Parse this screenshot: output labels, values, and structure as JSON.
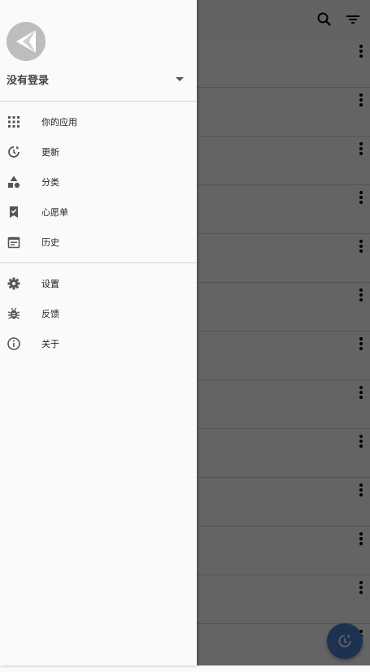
{
  "account": {
    "name": "没有登录"
  },
  "menu_primary": [
    {
      "label": "你的应用",
      "icon": "apps-grid-icon"
    },
    {
      "label": "更新",
      "icon": "update-icon"
    },
    {
      "label": "分类",
      "icon": "category-icon"
    },
    {
      "label": "心愿单",
      "icon": "bookmark-check-icon"
    },
    {
      "label": "历史",
      "icon": "history-icon"
    }
  ],
  "menu_secondary": [
    {
      "label": "设置",
      "icon": "gear-icon"
    },
    {
      "label": "反馈",
      "icon": "bug-icon"
    },
    {
      "label": "关于",
      "icon": "info-icon"
    }
  ],
  "toolbar_icons": [
    "search-icon",
    "filter-icon"
  ],
  "colors": {
    "fab": "#4a7ec7",
    "drawer_bg": "#fafafa",
    "scrim": "rgba(0,0,0,0.6)",
    "icon": "#555555"
  }
}
